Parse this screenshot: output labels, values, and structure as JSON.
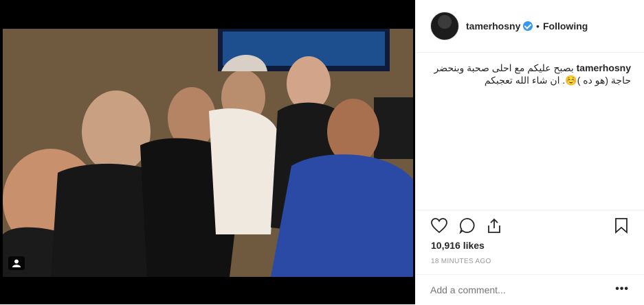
{
  "post": {
    "username": "tamerhosny",
    "dot": "•",
    "follow_status": "Following",
    "caption_username": "tamerhosny",
    "caption_text": " بصبح عليكم مع احلى صحبة وبنحضر حاجة (هو ده )☺️. ان شاء الله تعجبكم",
    "likes": "10,916 likes",
    "timestamp": "18 MINUTES AGO",
    "comment_placeholder": "Add a comment...",
    "more_label": "•••"
  },
  "icons": {
    "verified": "verified-badge-icon",
    "like": "heart-icon",
    "comment": "comment-bubble-icon",
    "share": "share-icon",
    "save": "bookmark-icon",
    "user_tag": "person-icon"
  },
  "colors": {
    "verified": "#3897f0",
    "text": "#262626",
    "muted": "#999999",
    "border": "#efefef"
  }
}
